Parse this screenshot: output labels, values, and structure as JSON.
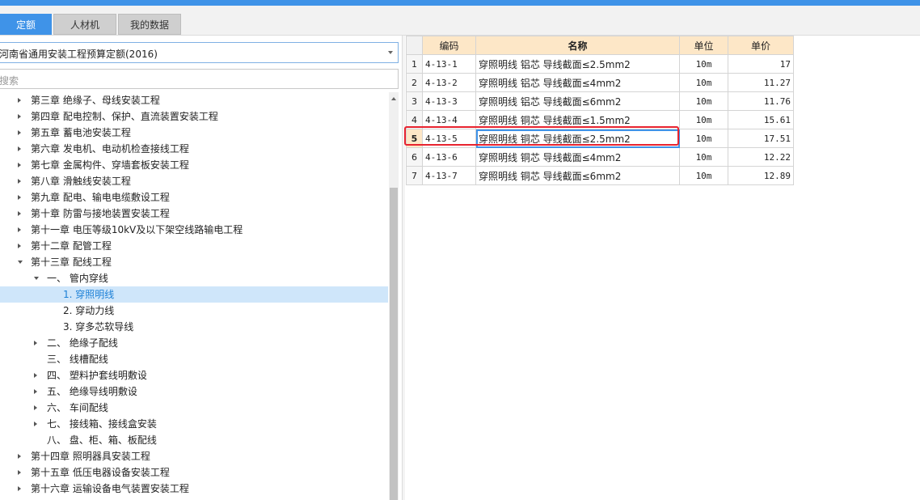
{
  "tabs": [
    {
      "label": "定额",
      "active": true
    },
    {
      "label": "人材机",
      "active": false
    },
    {
      "label": "我的数据",
      "active": false
    }
  ],
  "library": {
    "selected": "河南省通用安装工程预算定额(2016)"
  },
  "search": {
    "placeholder": "搜索"
  },
  "tree": [
    {
      "label": "第三章 绝缘子、母线安装工程",
      "level": 0,
      "state": "closed"
    },
    {
      "label": "第四章 配电控制、保护、直流装置安装工程",
      "level": 0,
      "state": "closed"
    },
    {
      "label": "第五章 蓄电池安装工程",
      "level": 0,
      "state": "closed"
    },
    {
      "label": "第六章 发电机、电动机检查接线工程",
      "level": 0,
      "state": "closed"
    },
    {
      "label": "第七章 金属构件、穿墙套板安装工程",
      "level": 0,
      "state": "closed"
    },
    {
      "label": "第八章 滑触线安装工程",
      "level": 0,
      "state": "closed"
    },
    {
      "label": "第九章 配电、输电电缆敷设工程",
      "level": 0,
      "state": "closed"
    },
    {
      "label": "第十章 防雷与接地装置安装工程",
      "level": 0,
      "state": "closed"
    },
    {
      "label": "第十一章 电压等级10kV及以下架空线路输电工程",
      "level": 0,
      "state": "closed"
    },
    {
      "label": "第十二章 配管工程",
      "level": 0,
      "state": "closed"
    },
    {
      "label": "第十三章 配线工程",
      "level": 0,
      "state": "open"
    },
    {
      "label": "一、 管内穿线",
      "level": 1,
      "state": "open"
    },
    {
      "label": "1. 穿照明线",
      "level": 2,
      "state": "none",
      "selected": true
    },
    {
      "label": "2. 穿动力线",
      "level": 2,
      "state": "none"
    },
    {
      "label": "3. 穿多芯软导线",
      "level": 2,
      "state": "none"
    },
    {
      "label": "二、 绝缘子配线",
      "level": 1,
      "state": "closed"
    },
    {
      "label": "三、 线槽配线",
      "level": 1,
      "state": "none"
    },
    {
      "label": "四、 塑料护套线明敷设",
      "level": 1,
      "state": "closed"
    },
    {
      "label": "五、 绝缘导线明敷设",
      "level": 1,
      "state": "closed"
    },
    {
      "label": "六、 车间配线",
      "level": 1,
      "state": "closed"
    },
    {
      "label": "七、 接线箱、接线盒安装",
      "level": 1,
      "state": "closed"
    },
    {
      "label": "八、 盘、柜、箱、板配线",
      "level": 1,
      "state": "none"
    },
    {
      "label": "第十四章 照明器具安装工程",
      "level": 0,
      "state": "closed"
    },
    {
      "label": "第十五章 低压电器设备安装工程",
      "level": 0,
      "state": "closed"
    },
    {
      "label": "第十六章 运输设备电气装置安装工程",
      "level": 0,
      "state": "closed"
    }
  ],
  "grid": {
    "columns": [
      "",
      "编码",
      "名称",
      "单位",
      "单价"
    ],
    "rows": [
      {
        "no": "1",
        "code": "4-13-1",
        "name": "穿照明线 铝芯 导线截面≤2.5mm2",
        "unit": "10m",
        "price": "17"
      },
      {
        "no": "2",
        "code": "4-13-2",
        "name": "穿照明线 铝芯 导线截面≤4mm2",
        "unit": "10m",
        "price": "11.27"
      },
      {
        "no": "3",
        "code": "4-13-3",
        "name": "穿照明线 铝芯 导线截面≤6mm2",
        "unit": "10m",
        "price": "11.76"
      },
      {
        "no": "4",
        "code": "4-13-4",
        "name": "穿照明线 铜芯 导线截面≤1.5mm2",
        "unit": "10m",
        "price": "15.61"
      },
      {
        "no": "5",
        "code": "4-13-5",
        "name": "穿照明线 铜芯 导线截面≤2.5mm2",
        "unit": "10m",
        "price": "17.51",
        "highlight": true
      },
      {
        "no": "6",
        "code": "4-13-6",
        "name": "穿照明线 铜芯 导线截面≤4mm2",
        "unit": "10m",
        "price": "12.22"
      },
      {
        "no": "7",
        "code": "4-13-7",
        "name": "穿照明线 铜芯 导线截面≤6mm2",
        "unit": "10m",
        "price": "12.89"
      }
    ]
  },
  "colors": {
    "accent": "#3f93e8",
    "header_bg": "#fde7c7",
    "selection_bg": "#cfe6fa",
    "annotation": "#e8232f"
  }
}
